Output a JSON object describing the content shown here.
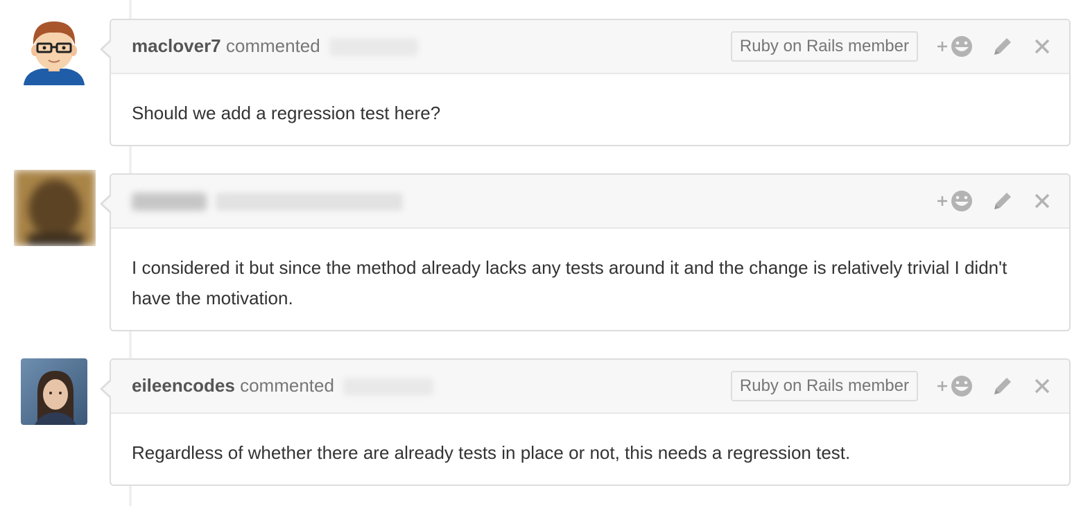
{
  "comments": [
    {
      "author": "maclover7",
      "action": "commented",
      "badge": "Ruby on Rails member",
      "body": "Should we add a regression test here?"
    },
    {
      "author": "",
      "action": "",
      "badge": "",
      "body": "I considered it but since the method already lacks any tests around it and the change is relatively trivial I didn't have the motivation."
    },
    {
      "author": "eileencodes",
      "action": "commented",
      "badge": "Ruby on Rails member",
      "body": "Regardless of whether there are already tests in place or not, this needs a regression test."
    }
  ],
  "actions": {
    "react_plus": "+",
    "react_icon": "smiley-icon",
    "edit_icon": "pencil-icon",
    "delete_icon": "close-icon"
  },
  "colors": {
    "header_bg": "#f7f7f7",
    "border": "#dddddd",
    "icon": "#aaaaaa",
    "text": "#333333",
    "muted": "#767676"
  }
}
